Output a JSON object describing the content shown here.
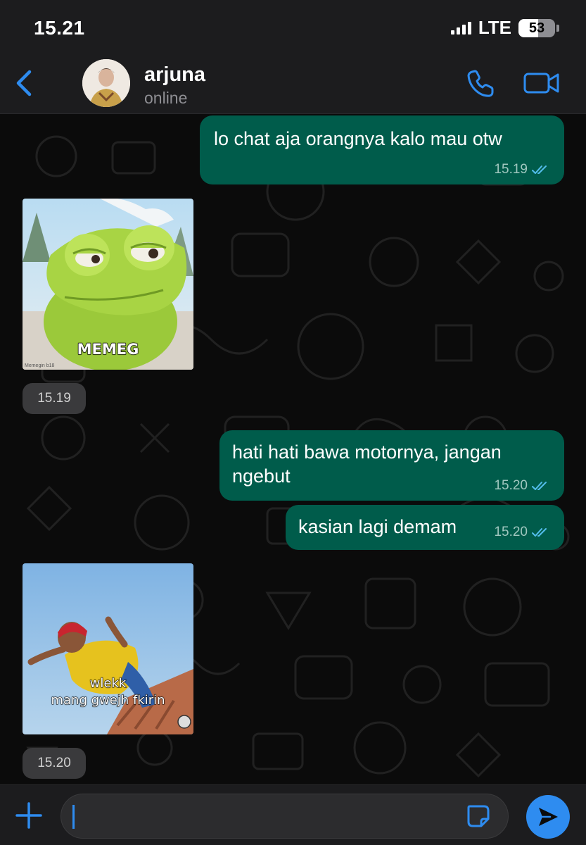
{
  "status_bar": {
    "time": "15.21",
    "network": "LTE",
    "battery_level": "53"
  },
  "header": {
    "contact_name": "arjuna",
    "presence": "online"
  },
  "messages": [
    {
      "direction": "out",
      "text": "lo chat aja orangnya kalo mau otw",
      "time": "15.19",
      "status": "read"
    },
    {
      "direction": "in",
      "type": "sticker",
      "caption": "MEMEG",
      "watermark": "Memegin b18",
      "time": "15.19"
    },
    {
      "direction": "out",
      "text": "hati hati bawa motornya, jangan ngebut",
      "time": "15.20",
      "status": "read"
    },
    {
      "direction": "out",
      "text": "kasian lagi demam",
      "time": "15.20",
      "status": "read"
    },
    {
      "direction": "in",
      "type": "sticker",
      "caption_line1": "wlekk",
      "caption_line2": "mang gwejh fkirin",
      "time": "15.20"
    }
  ],
  "composer": {
    "placeholder": ""
  },
  "icons": {
    "back": "chevron-left-icon",
    "call": "phone-icon",
    "video": "video-camera-icon",
    "attach": "plus-icon",
    "sticker": "sticker-icon",
    "send": "send-icon"
  },
  "colors": {
    "accent": "#2e8cf0",
    "outgoing_bubble": "#005c4b",
    "background": "#0b0b0b",
    "bar": "#1c1c1e",
    "read_ticks": "#53bdeb"
  }
}
